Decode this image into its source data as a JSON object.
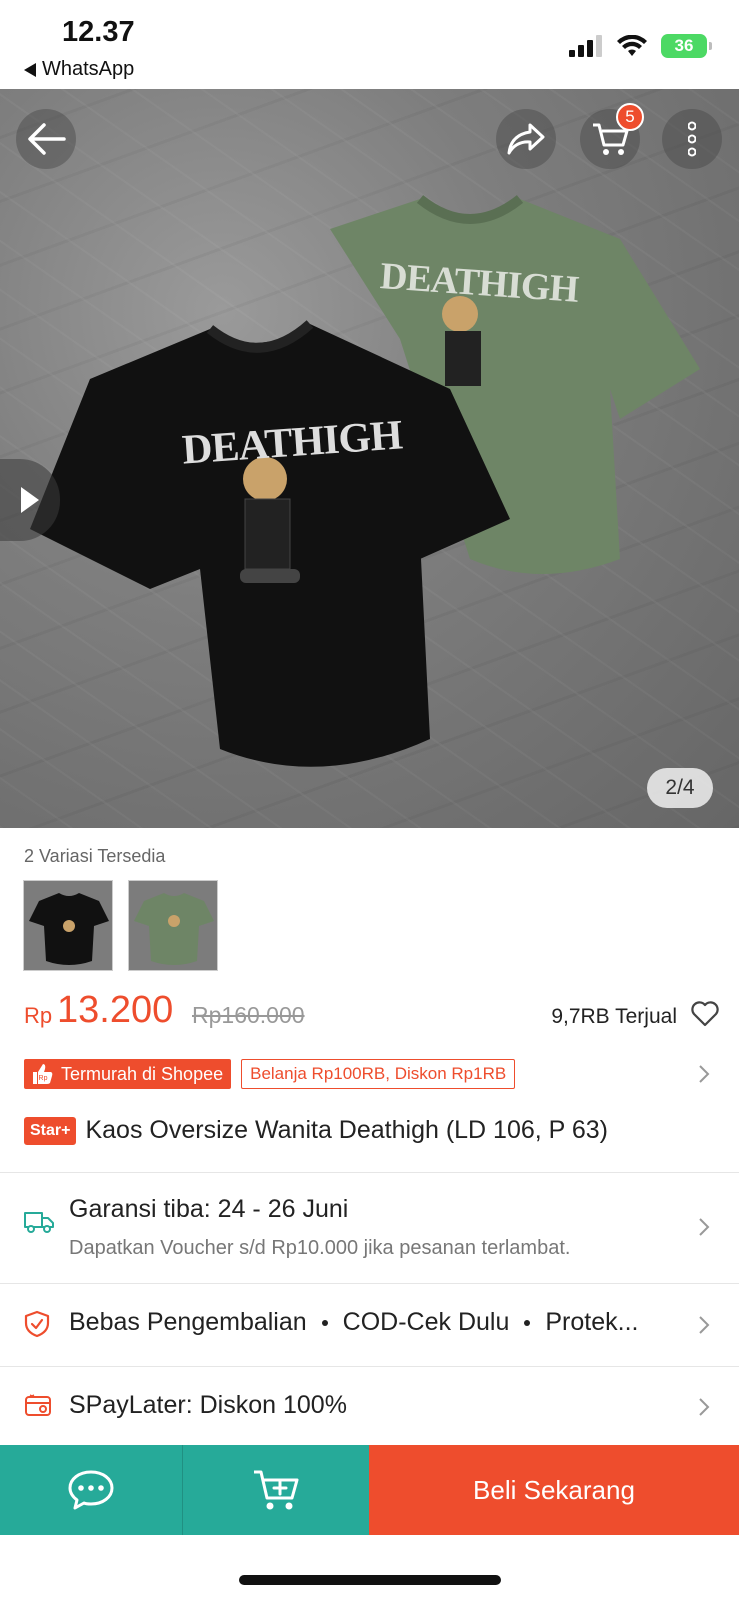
{
  "status_bar": {
    "time": "12.37",
    "back_app": "WhatsApp",
    "battery": "36"
  },
  "hero": {
    "cart_count": "5",
    "page_indicator": "2/4",
    "shirt_print": "DEATHIGH"
  },
  "variants": {
    "label": "2 Variasi Tersedia",
    "items": [
      "black",
      "green"
    ]
  },
  "price": {
    "currency": "Rp",
    "current": "13.200",
    "original": "Rp160.000",
    "sold": "9,7RB Terjual"
  },
  "badges": {
    "cheapest": "Termurah di Shopee",
    "discount": "Belanja Rp100RB, Diskon Rp1RB"
  },
  "product": {
    "star_badge": "Star+",
    "title": "Kaos Oversize Wanita Deathigh (LD 106, P 63)"
  },
  "shipping": {
    "title": "Garansi tiba: 24 - 26 Juni",
    "subtitle": "Dapatkan Voucher s/d Rp10.000 jika pesanan terlambat."
  },
  "guarantees": {
    "items": [
      "Bebas Pengembalian",
      "COD-Cek Dulu",
      "Protek..."
    ]
  },
  "paylater": {
    "text": "SPayLater: Diskon 100%"
  },
  "bottom_bar": {
    "buy_label": "Beli Sekarang"
  },
  "colors": {
    "accent": "#ee4d2d",
    "teal": "#26aa99"
  },
  "icons": [
    "back-arrow-icon",
    "share-icon",
    "cart-icon",
    "more-icon",
    "play-icon",
    "heart-icon",
    "truck-icon",
    "shield-icon",
    "paylater-icon",
    "chat-icon",
    "add-to-cart-icon",
    "chevron-right-icon"
  ]
}
